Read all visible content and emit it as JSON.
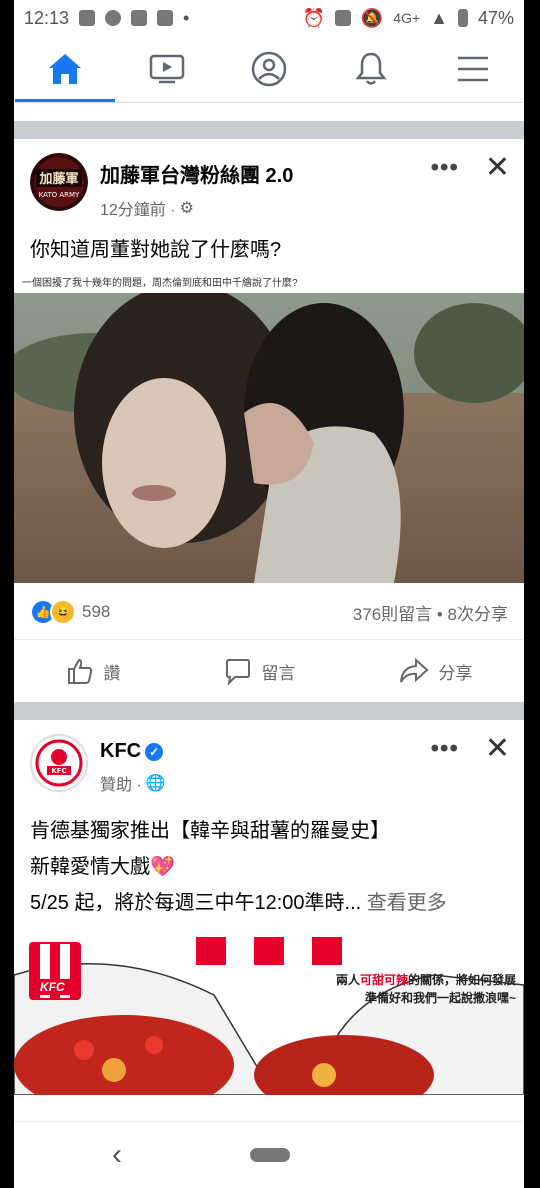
{
  "status": {
    "time": "12:13",
    "network": "4G+",
    "battery": "47%"
  },
  "post1": {
    "page_name": "加藤軍台灣粉絲團 2.0",
    "time": "12分鐘前 ·",
    "avatar_label": "KATO ARMY",
    "text": "你知道周董對她說了什麼嗎?",
    "image_caption": "一個困擾了我十幾年的問題，周杰倫到底和田中千繪說了什麼?",
    "reaction_count": "598",
    "comments_shares": "376則留言 • 8次分享",
    "actions": {
      "like": "讚",
      "comment": "留言",
      "share": "分享"
    }
  },
  "post2": {
    "page_name": "KFC",
    "meta": "贊助 ·",
    "line1": "肯德基獨家推出【韓辛與甜薯的羅曼史】",
    "line2": "新韓愛情大戲💖",
    "line3": "5/25 起，將於每週三中午12:00準時...",
    "more": "查看更多",
    "banner_line1_a": "兩人",
    "banner_line1_b": "可甜可辣",
    "banner_line1_c": "的關係，將如何發展",
    "banner_line2": "準備好和我們一起說撒浪嘿~",
    "logo_text": "KFC"
  },
  "colors": {
    "accent": "#1877f2",
    "kfc_red": "#e4002b"
  }
}
